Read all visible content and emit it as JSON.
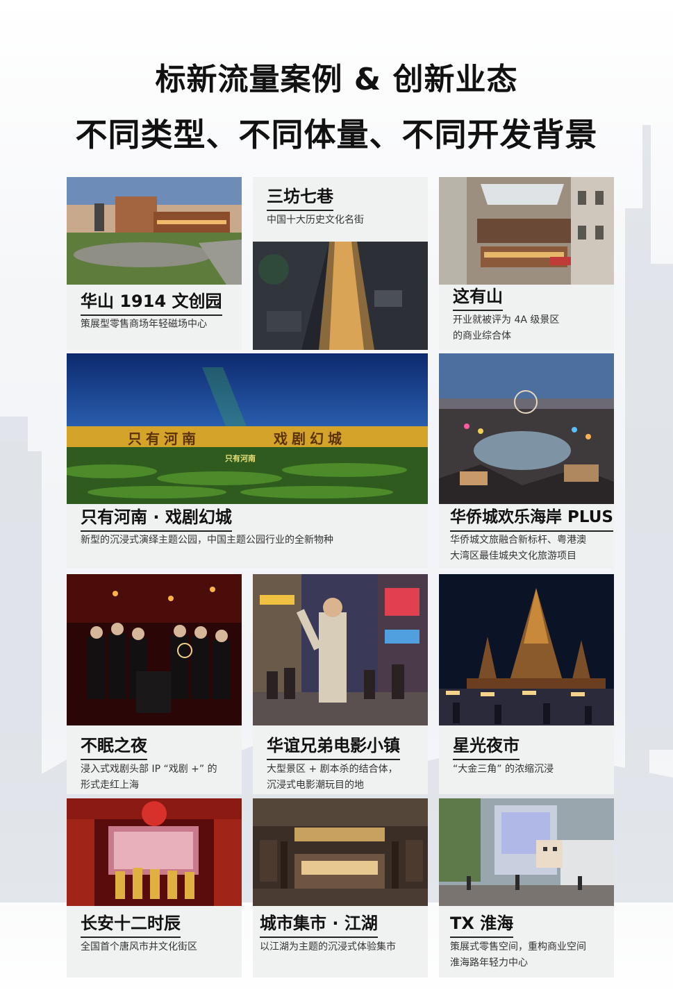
{
  "header": {
    "line1": "标新流量案例 & 创新业态",
    "line2": "不同类型、不同体量、不同开发背景"
  },
  "cards": [
    {
      "title": "华山 1914 文创园",
      "desc": "策展型零售商场年轻磁场中心",
      "photo_label": "huashan-1914-photo"
    },
    {
      "title": "三坊七巷",
      "desc": "中国十大历史文化名街",
      "photo_label": "sanfang-qixiang-photo"
    },
    {
      "title": "这有山",
      "desc": [
        "开业就被评为 4A 级景区",
        "的商业综合体"
      ],
      "photo_label": "zheyoushan-photo"
    },
    {
      "title": "只有河南 · 戏剧幻城",
      "desc": "新型的沉浸式演绎主题公园，中国主题公园行业的全新物种",
      "photo_label": "zhiyou-henan-photo",
      "sign_left": "只有河南",
      "sign_right": "戏剧幻城",
      "sign_small": "只有河南"
    },
    {
      "title": "华侨城欢乐海岸 PLUS",
      "desc": [
        "华侨城文旅融合新标杆、粤港澳",
        "大湾区最佳城央文化旅游项目"
      ],
      "photo_label": "happy-coast-photo"
    },
    {
      "title": "不眠之夜",
      "desc": [
        "浸入式戏剧头部 IP “戏剧 +” 的",
        "形式走红上海"
      ],
      "photo_label": "sleep-no-more-photo"
    },
    {
      "title": "华谊兄弟电影小镇",
      "desc": [
        "大型景区 + 剧本杀的结合体，",
        "沉浸式电影潮玩目的地"
      ],
      "photo_label": "huayi-film-town-photo"
    },
    {
      "title": "星光夜市",
      "desc": "“大金三角” 的浓缩沉浸",
      "photo_label": "starlight-night-market-photo"
    },
    {
      "title": "长安十二时辰",
      "desc": "全国首个唐风市井文化街区",
      "photo_label": "changan-photo"
    },
    {
      "title": "城市集市 · 江湖",
      "desc": "以江湖为主题的沉浸式体验集市",
      "photo_label": "city-market-photo"
    },
    {
      "title": "TX 淮海",
      "desc": [
        "策展式零售空间，重构商业空间",
        "淮海路年轻力中心"
      ],
      "photo_label": "tx-huaihai-photo"
    }
  ],
  "colors": {
    "card_bg": "#f0f1f1",
    "title_text": "#111111",
    "desc_text": "#333333"
  }
}
